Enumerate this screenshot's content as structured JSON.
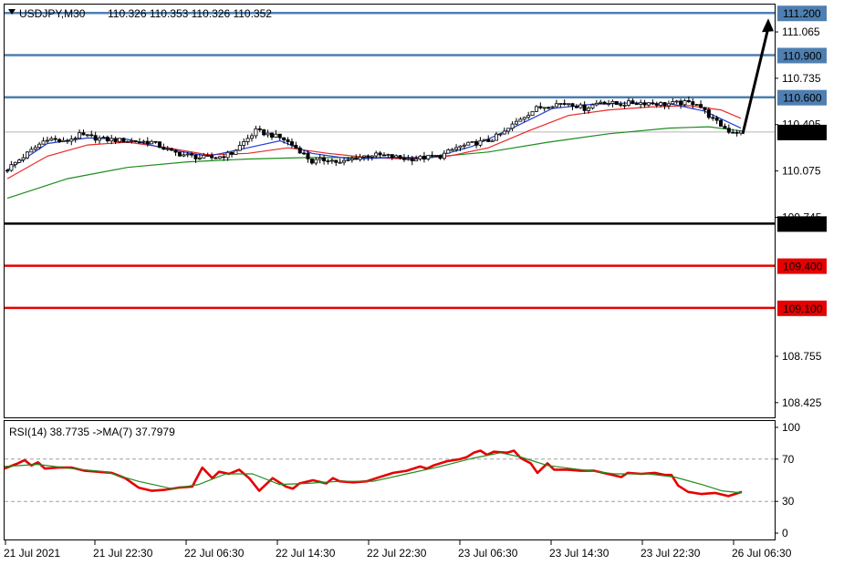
{
  "header": {
    "symbol_caption": "USDJPY,M30",
    "ohlc_caption": "110.326 110.353 110.326 110.352"
  },
  "rsi_header": {
    "caption": "RSI(14) 38.7735  ->MA(7) 37.7979"
  },
  "colors": {
    "bull_candle": "#ffffff",
    "bear_candle": "#000000",
    "ma_fast": "#1f3fd4",
    "ma_mid": "#e82828",
    "ma_slow": "#1e8c1e",
    "resistance": "#4e7fb0",
    "pivot": "#000000",
    "support": "#e60000",
    "rsi_line": "#e60000",
    "rsi_ma": "#1e8c1e"
  },
  "chart_data": [
    {
      "type": "candlestick",
      "symbol": "USDJPY",
      "timeframe": "M30",
      "last_price": 110.352,
      "ylim": [
        108.32,
        111.26
      ],
      "y_ticks": [
        "111.065",
        "110.735",
        "110.405",
        "110.075",
        "109.745",
        "108.755",
        "108.425"
      ],
      "x_ticks": [
        "21 Jul 2021",
        "21 Jul 22:30",
        "22 Jul 06:30",
        "22 Jul 14:30",
        "22 Jul 22:30",
        "23 Jul 06:30",
        "23 Jul 14:30",
        "23 Jul 22:30",
        "26 Jul 06:30"
      ],
      "levels": [
        {
          "price": 111.2,
          "label": "111.200",
          "kind": "resistance"
        },
        {
          "price": 110.9,
          "label": "110.900",
          "kind": "resistance"
        },
        {
          "price": 110.6,
          "label": "110.600",
          "kind": "resistance"
        },
        {
          "price": 109.7,
          "label": "109.700",
          "kind": "pivot"
        },
        {
          "price": 109.4,
          "label": "109.400",
          "kind": "support"
        },
        {
          "price": 109.1,
          "label": "109.100",
          "kind": "support"
        }
      ],
      "price_path": [
        [
          0,
          110.09
        ],
        [
          6,
          110.22
        ],
        [
          10,
          110.31
        ],
        [
          14,
          110.28
        ],
        [
          18,
          110.33
        ],
        [
          24,
          110.3
        ],
        [
          30,
          110.29
        ],
        [
          36,
          110.28
        ],
        [
          41,
          110.21
        ],
        [
          44,
          110.19
        ],
        [
          48,
          110.17
        ],
        [
          52,
          110.17
        ],
        [
          56,
          110.2
        ],
        [
          62,
          110.36
        ],
        [
          66,
          110.33
        ],
        [
          69,
          110.3
        ],
        [
          73,
          110.22
        ],
        [
          76,
          110.14
        ],
        [
          80,
          110.16
        ],
        [
          83,
          110.13
        ],
        [
          87,
          110.17
        ],
        [
          91,
          110.19
        ],
        [
          95,
          110.18
        ],
        [
          100,
          110.16
        ],
        [
          104,
          110.17
        ],
        [
          108,
          110.18
        ],
        [
          112,
          110.24
        ],
        [
          116,
          110.27
        ],
        [
          120,
          110.29
        ],
        [
          124,
          110.35
        ],
        [
          128,
          110.45
        ],
        [
          132,
          110.52
        ],
        [
          136,
          110.55
        ],
        [
          140,
          110.56
        ],
        [
          144,
          110.52
        ],
        [
          148,
          110.57
        ],
        [
          152,
          110.55
        ],
        [
          156,
          110.56
        ],
        [
          160,
          110.56
        ],
        [
          164,
          110.55
        ],
        [
          168,
          110.56
        ],
        [
          172,
          110.56
        ],
        [
          176,
          110.44
        ],
        [
          180,
          110.36
        ],
        [
          183,
          110.35
        ]
      ],
      "arrow_target": 111.2,
      "series": [
        {
          "name": "",
          "role": "ma_fast",
          "values": [
            [
              0,
              110.08
            ],
            [
              10,
              110.27
            ],
            [
              20,
              110.31
            ],
            [
              30,
              110.3
            ],
            [
              40,
              110.23
            ],
            [
              50,
              110.18
            ],
            [
              60,
              110.24
            ],
            [
              68,
              110.29
            ],
            [
              76,
              110.2
            ],
            [
              86,
              110.16
            ],
            [
              96,
              110.17
            ],
            [
              106,
              110.17
            ],
            [
              116,
              110.25
            ],
            [
              126,
              110.38
            ],
            [
              136,
              110.52
            ],
            [
              146,
              110.55
            ],
            [
              156,
              110.56
            ],
            [
              166,
              110.55
            ],
            [
              174,
              110.5
            ],
            [
              183,
              110.38
            ]
          ]
        },
        {
          "name": "",
          "role": "ma_mid",
          "values": [
            [
              0,
              110.02
            ],
            [
              10,
              110.18
            ],
            [
              20,
              110.26
            ],
            [
              30,
              110.28
            ],
            [
              40,
              110.24
            ],
            [
              50,
              110.19
            ],
            [
              60,
              110.2
            ],
            [
              70,
              110.24
            ],
            [
              80,
              110.2
            ],
            [
              90,
              110.17
            ],
            [
              100,
              110.16
            ],
            [
              110,
              110.18
            ],
            [
              120,
              110.24
            ],
            [
              130,
              110.36
            ],
            [
              140,
              110.47
            ],
            [
              150,
              110.51
            ],
            [
              160,
              110.53
            ],
            [
              170,
              110.54
            ],
            [
              178,
              110.51
            ],
            [
              183,
              110.45
            ]
          ]
        },
        {
          "name": "",
          "role": "ma_slow",
          "values": [
            [
              0,
              109.88
            ],
            [
              15,
              110.02
            ],
            [
              30,
              110.1
            ],
            [
              45,
              110.14
            ],
            [
              60,
              110.16
            ],
            [
              75,
              110.17
            ],
            [
              90,
              110.17
            ],
            [
              105,
              110.17
            ],
            [
              120,
              110.21
            ],
            [
              135,
              110.28
            ],
            [
              150,
              110.34
            ],
            [
              165,
              110.38
            ],
            [
              175,
              110.39
            ],
            [
              183,
              110.36
            ]
          ]
        }
      ]
    },
    {
      "type": "line",
      "indicator": "RSI",
      "ylim": [
        -6,
        106
      ],
      "y_ticks": [
        "100",
        "70",
        "30",
        "0"
      ],
      "reference_lines": [
        70,
        30
      ],
      "x_ticks": [
        "21 Jul 2021",
        "21 Jul 22:30",
        "22 Jul 06:30",
        "22 Jul 14:30",
        "22 Jul 22:30",
        "23 Jul 06:30",
        "23 Jul 14:30",
        "23 Jul 22:30",
        "26 Jul 06:30"
      ],
      "series": [
        {
          "name": "",
          "role": "rsi",
          "values": [
            [
              0,
              61
            ],
            [
              4,
              66
            ],
            [
              6,
              69
            ],
            [
              8,
              64
            ],
            [
              10,
              67
            ],
            [
              12,
              61
            ],
            [
              16,
              62
            ],
            [
              20,
              62
            ],
            [
              24,
              59
            ],
            [
              28,
              58
            ],
            [
              32,
              57
            ],
            [
              36,
              52
            ],
            [
              40,
              43
            ],
            [
              44,
              40
            ],
            [
              48,
              41
            ],
            [
              52,
              43
            ],
            [
              56,
              44
            ],
            [
              59,
              62
            ],
            [
              62,
              52
            ],
            [
              64,
              58
            ],
            [
              67,
              56
            ],
            [
              70,
              60
            ],
            [
              73,
              52
            ],
            [
              76,
              40
            ],
            [
              78,
              46
            ],
            [
              80,
              52
            ],
            [
              84,
              44
            ],
            [
              86,
              42
            ],
            [
              88,
              47
            ],
            [
              92,
              50
            ],
            [
              96,
              47
            ],
            [
              98,
              52
            ],
            [
              100,
              49
            ],
            [
              104,
              48
            ],
            [
              108,
              49
            ],
            [
              112,
              53
            ],
            [
              116,
              57
            ],
            [
              120,
              59
            ],
            [
              124,
              63
            ],
            [
              126,
              61
            ],
            [
              128,
              64
            ],
            [
              132,
              68
            ],
            [
              136,
              70
            ],
            [
              138,
              72
            ],
            [
              140,
              76
            ],
            [
              142,
              78
            ],
            [
              144,
              74
            ],
            [
              146,
              77
            ],
            [
              150,
              76
            ],
            [
              152,
              78
            ],
            [
              154,
              71
            ],
            [
              157,
              66
            ],
            [
              159,
              57
            ],
            [
              162,
              66
            ],
            [
              164,
              60
            ],
            [
              168,
              60
            ],
            [
              172,
              59
            ],
            [
              176,
              59
            ],
            [
              180,
              56
            ],
            [
              184,
              53
            ],
            [
              186,
              57
            ],
            [
              190,
              56
            ],
            [
              194,
              57
            ],
            [
              197,
              55
            ],
            [
              199,
              55
            ],
            [
              201,
              45
            ],
            [
              204,
              39
            ],
            [
              208,
              37
            ],
            [
              212,
              38
            ],
            [
              216,
              35
            ],
            [
              220,
              39
            ]
          ]
        },
        {
          "name": "",
          "role": "rsi_ma",
          "values": [
            [
              0,
              63
            ],
            [
              10,
              65
            ],
            [
              20,
              61
            ],
            [
              30,
              58
            ],
            [
              40,
              49
            ],
            [
              50,
              42
            ],
            [
              58,
              46
            ],
            [
              66,
              56
            ],
            [
              74,
              56
            ],
            [
              82,
              46
            ],
            [
              90,
              47
            ],
            [
              100,
              49
            ],
            [
              110,
              49
            ],
            [
              120,
              56
            ],
            [
              130,
              63
            ],
            [
              140,
              71
            ],
            [
              148,
              76
            ],
            [
              154,
              72
            ],
            [
              162,
              64
            ],
            [
              172,
              60
            ],
            [
              182,
              56
            ],
            [
              192,
              56
            ],
            [
              200,
              53
            ],
            [
              208,
              46
            ],
            [
              214,
              40
            ],
            [
              220,
              38
            ]
          ]
        }
      ]
    }
  ]
}
